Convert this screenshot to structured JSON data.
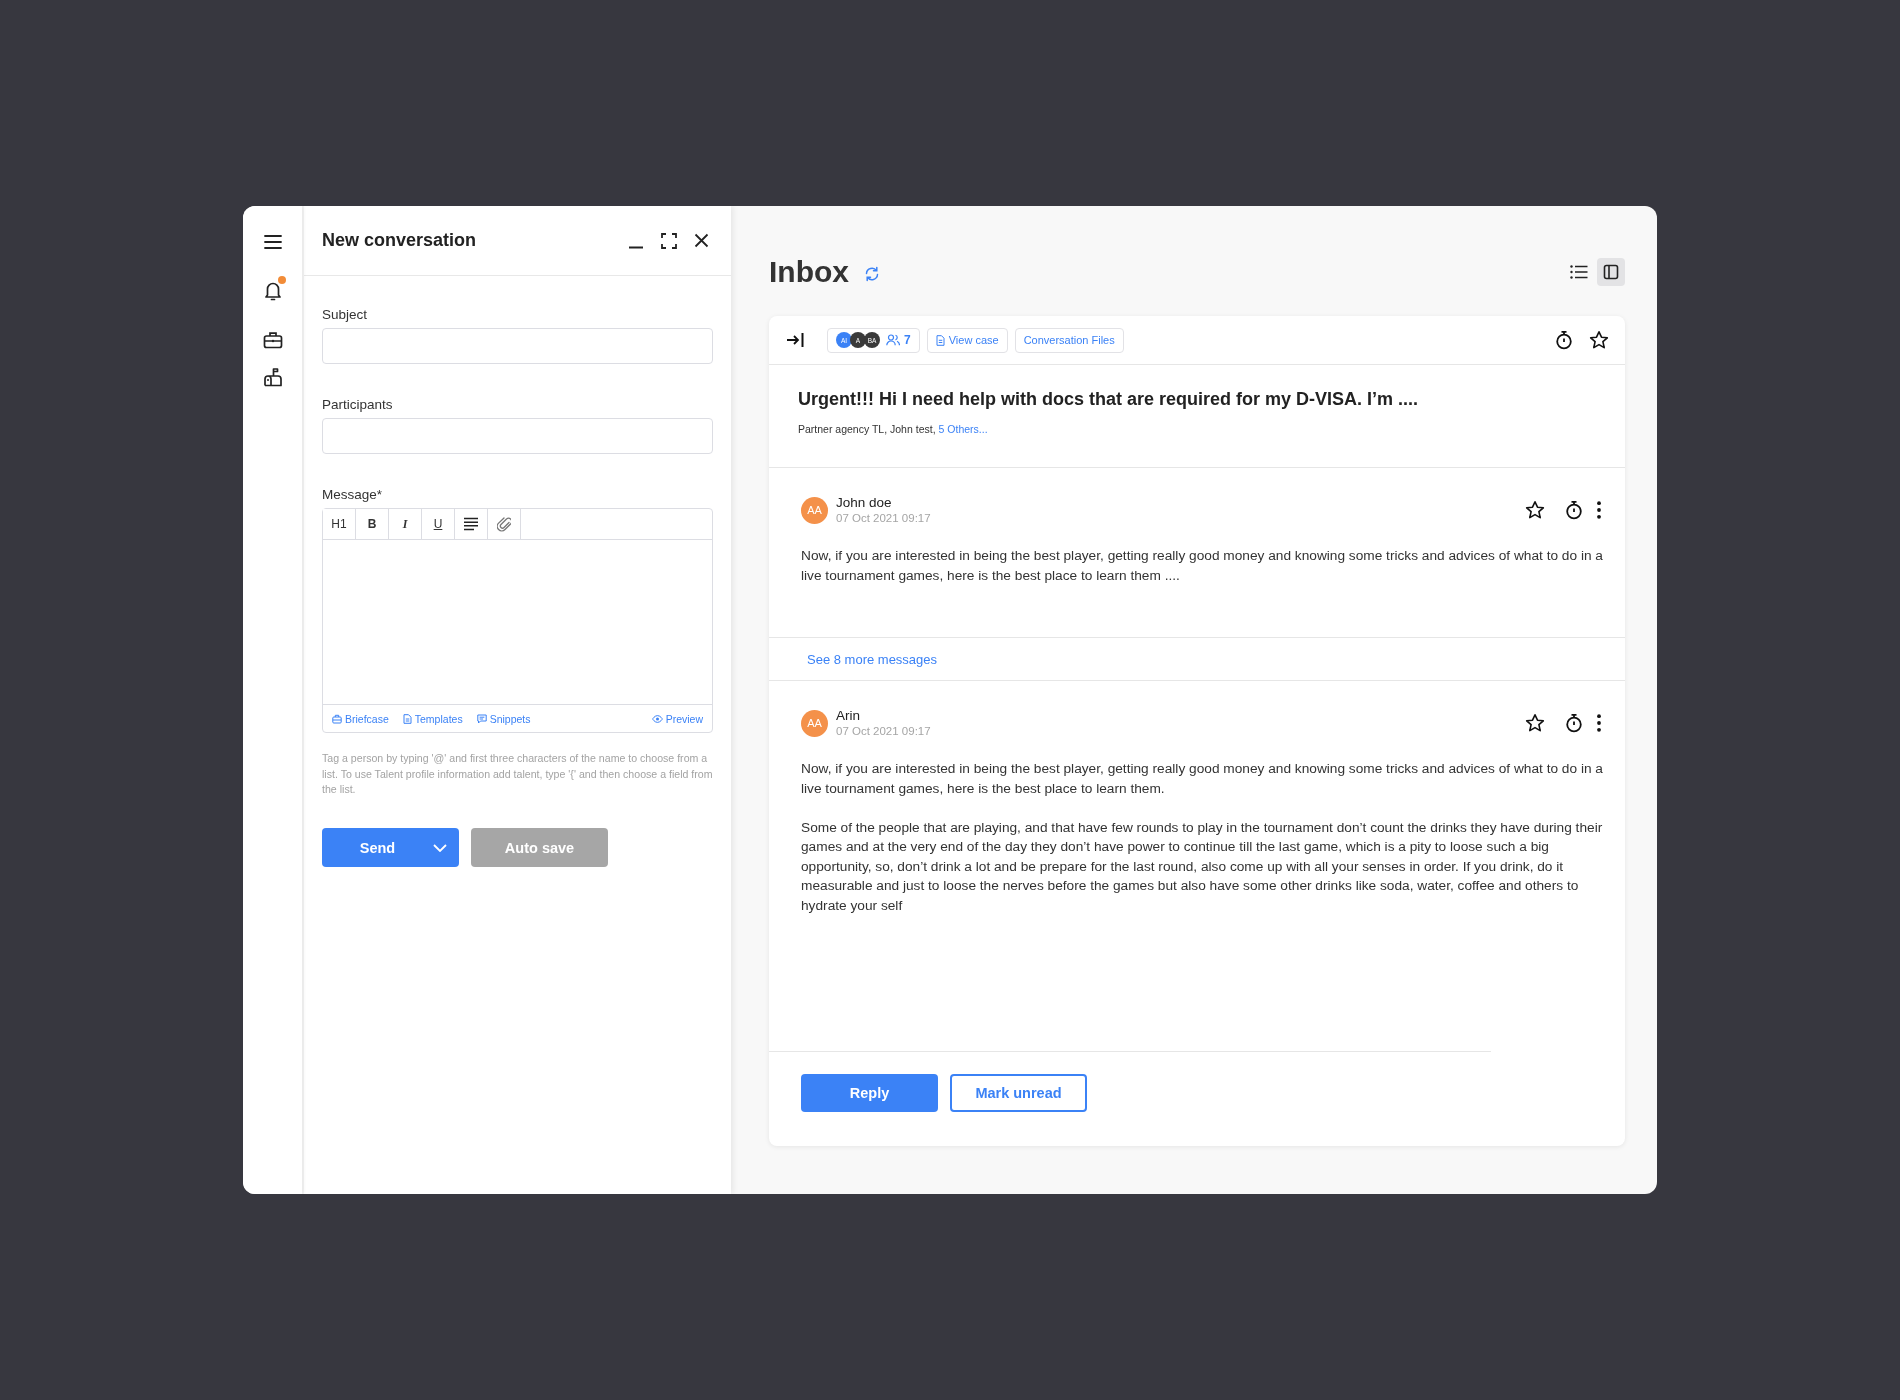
{
  "nav_rail": {
    "notification_dot": true
  },
  "compose": {
    "title": "New conversation",
    "fields": [
      {
        "label": "Subject"
      },
      {
        "label": "Participants"
      }
    ],
    "message": {
      "label": "Message*",
      "format_buttons": [
        "H1",
        "B",
        "I",
        "U"
      ],
      "insert_links": [
        {
          "label": "Briefcase"
        },
        {
          "label": "Templates"
        },
        {
          "label": "Snippets"
        }
      ],
      "preview": "Preview"
    },
    "hint": "Tag a person by typing '@' and first three characters of the name to choose from a list. To use Talent profile information add talent, type '{' and then choose a field from the list.",
    "buttons": [
      {
        "label": "Send",
        "kind": "split",
        "disabled": false
      },
      {
        "label": "Auto save",
        "kind": "plain",
        "disabled": true
      }
    ]
  },
  "inbox": {
    "title": "Inbox",
    "views": [
      {
        "selected": false
      },
      {
        "selected": true
      }
    ],
    "conversation": {
      "participants": {
        "avatars": [
          {
            "initials": "AI",
            "color": "#3b82f6"
          },
          {
            "initials": "A",
            "color": "#3a3a3a"
          },
          {
            "initials": "BA",
            "color": "#3a3a3a"
          }
        ],
        "count": "7"
      },
      "links": [
        {
          "label": "View case",
          "kind": "with_icon"
        },
        {
          "label": "Conversation Files",
          "kind": "text"
        }
      ],
      "starred": false,
      "subject": "Urgent!!! Hi I need help with docs that are required for my D-VISA. I’m ....",
      "recipients": "Partner agency TL, John test,",
      "recipients_more": "5 Others...",
      "thread": [
        {
          "kind": "message",
          "sender": "John doe",
          "initials": "AA",
          "time": "07 Oct 2021 09:17",
          "starred": false,
          "paragraphs": [
            "Now, if you are interested in being the best player, getting really good money and knowing some tricks and advices of what to do in a live tournament games, here is the best place to learn them ...."
          ]
        },
        {
          "kind": "more",
          "label": "See 8 more messages"
        },
        {
          "kind": "message",
          "sender": "Arin",
          "initials": "AA",
          "time": "07 Oct 2021 09:17",
          "starred": false,
          "paragraphs": [
            "Now, if you are interested in being the best player, getting really good money and knowing some tricks and advices of what to do in a live tournament games, here is the best place to learn them.",
            "Some of the people that are playing, and that have few rounds to play in the tournament don’t count the drinks they have during their games and at the very end of the day they don’t have power to continue till the last game, which is a pity to loose such a big opportunity, so, don’t drink a lot and be prepare for the last round, also come up with all your senses in order. If you drink, do it measurable and just to loose the nerves before the games but also have some other drinks like soda, water, coffee and others to hydrate your self"
          ]
        }
      ],
      "actions": [
        {
          "label": "Reply",
          "kind": "primary"
        },
        {
          "label": "Mark unread",
          "kind": "outline"
        }
      ]
    }
  }
}
